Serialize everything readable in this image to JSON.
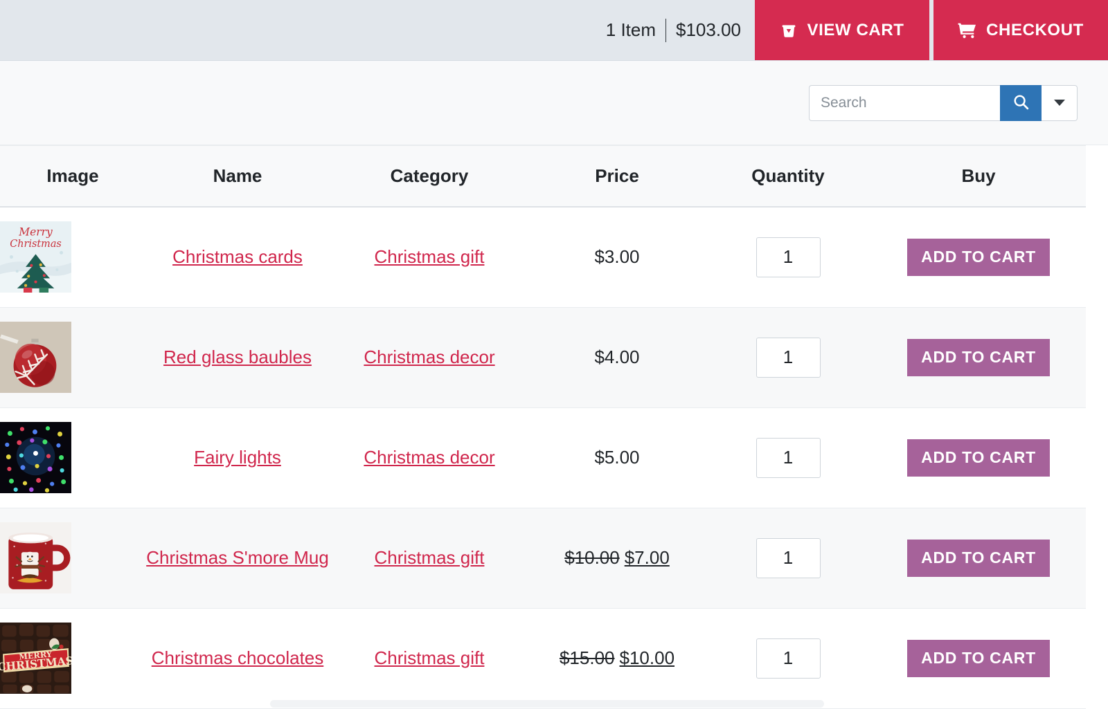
{
  "topbar": {
    "cart_count": "1 Item",
    "cart_total": "$103.00",
    "view_cart_label": "VIEW CART",
    "checkout_label": "CHECKOUT",
    "accent_color": "#d52b50",
    "background_color": "#e2e7ec"
  },
  "search": {
    "placeholder": "Search",
    "value": "",
    "button_color": "#2e74b5"
  },
  "table": {
    "headers": {
      "image": "Image",
      "name": "Name",
      "category": "Category",
      "price": "Price",
      "quantity": "Quantity",
      "buy": "Buy"
    },
    "add_to_cart_label": "ADD TO CART",
    "add_to_cart_color": "#a6629a",
    "link_color": "#d0264c",
    "rows": [
      {
        "image_name": "christmas-cards-thumbnail",
        "name": "Christmas cards",
        "category": "Christmas gift",
        "price": "$3.00",
        "price_old": "",
        "price_new": "",
        "quantity": "1"
      },
      {
        "image_name": "red-glass-baubles-thumbnail",
        "name": "Red glass baubles",
        "category": "Christmas decor",
        "price": "$4.00",
        "price_old": "",
        "price_new": "",
        "quantity": "1"
      },
      {
        "image_name": "fairy-lights-thumbnail",
        "name": "Fairy lights",
        "category": "Christmas decor",
        "price": "$5.00",
        "price_old": "",
        "price_new": "",
        "quantity": "1"
      },
      {
        "image_name": "christmas-smore-mug-thumbnail",
        "name": "Christmas S'more Mug",
        "category": "Christmas gift",
        "price": "",
        "price_old": "$10.00",
        "price_new": "$7.00",
        "quantity": "1"
      },
      {
        "image_name": "christmas-chocolates-thumbnail",
        "name": "Christmas chocolates",
        "category": "Christmas gift",
        "price": "",
        "price_old": "$15.00",
        "price_new": "$10.00",
        "quantity": "1"
      }
    ]
  }
}
